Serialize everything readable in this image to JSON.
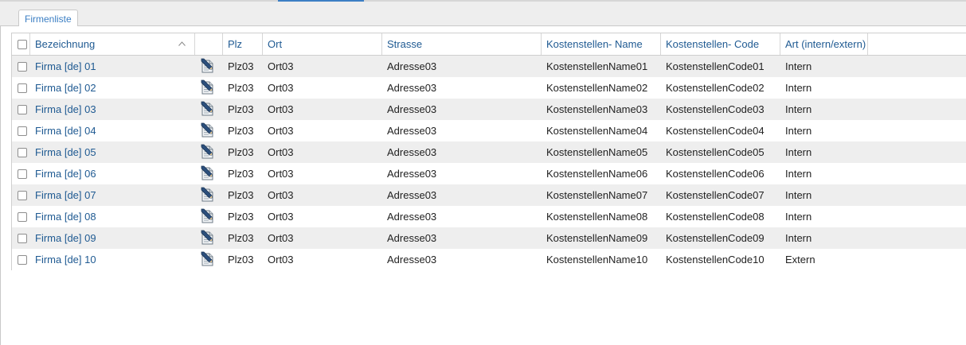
{
  "tabs": [
    {
      "label": "Firmenliste",
      "active": true
    }
  ],
  "table": {
    "columns": {
      "bezeichnung": "Bezeichnung",
      "plz": "Plz",
      "ort": "Ort",
      "strasse": "Strasse",
      "kostenstellen_name": "Kostenstellen- Name",
      "kostenstellen_code": "Kostenstellen- Code",
      "art": "Art (intern/extern)"
    },
    "sort": {
      "column": "bezeichnung",
      "direction": "ascending",
      "icon": "chevron-up-icon"
    },
    "rows": [
      {
        "bezeichnung": "Firma [de] 01",
        "plz": "Plz03",
        "ort": "Ort03",
        "strasse": "Adresse03",
        "kostenstellen_name": "KostenstellenName01",
        "kostenstellen_code": "KostenstellenCode01",
        "art": "Intern"
      },
      {
        "bezeichnung": "Firma [de] 02",
        "plz": "Plz03",
        "ort": "Ort03",
        "strasse": "Adresse03",
        "kostenstellen_name": "KostenstellenName02",
        "kostenstellen_code": "KostenstellenCode02",
        "art": "Intern"
      },
      {
        "bezeichnung": "Firma [de] 03",
        "plz": "Plz03",
        "ort": "Ort03",
        "strasse": "Adresse03",
        "kostenstellen_name": "KostenstellenName03",
        "kostenstellen_code": "KostenstellenCode03",
        "art": "Intern"
      },
      {
        "bezeichnung": "Firma [de] 04",
        "plz": "Plz03",
        "ort": "Ort03",
        "strasse": "Adresse03",
        "kostenstellen_name": "KostenstellenName04",
        "kostenstellen_code": "KostenstellenCode04",
        "art": "Intern"
      },
      {
        "bezeichnung": "Firma [de] 05",
        "plz": "Plz03",
        "ort": "Ort03",
        "strasse": "Adresse03",
        "kostenstellen_name": "KostenstellenName05",
        "kostenstellen_code": "KostenstellenCode05",
        "art": "Intern"
      },
      {
        "bezeichnung": "Firma [de] 06",
        "plz": "Plz03",
        "ort": "Ort03",
        "strasse": "Adresse03",
        "kostenstellen_name": "KostenstellenName06",
        "kostenstellen_code": "KostenstellenCode06",
        "art": "Intern"
      },
      {
        "bezeichnung": "Firma [de] 07",
        "plz": "Plz03",
        "ort": "Ort03",
        "strasse": "Adresse03",
        "kostenstellen_name": "KostenstellenName07",
        "kostenstellen_code": "KostenstellenCode07",
        "art": "Intern"
      },
      {
        "bezeichnung": "Firma [de] 08",
        "plz": "Plz03",
        "ort": "Ort03",
        "strasse": "Adresse03",
        "kostenstellen_name": "KostenstellenName08",
        "kostenstellen_code": "KostenstellenCode08",
        "art": "Intern"
      },
      {
        "bezeichnung": "Firma [de] 09",
        "plz": "Plz03",
        "ort": "Ort03",
        "strasse": "Adresse03",
        "kostenstellen_name": "KostenstellenName09",
        "kostenstellen_code": "KostenstellenCode09",
        "art": "Intern"
      },
      {
        "bezeichnung": "Firma [de] 10",
        "plz": "Plz03",
        "ort": "Ort03",
        "strasse": "Adresse03",
        "kostenstellen_name": "KostenstellenName10",
        "kostenstellen_code": "KostenstellenCode10",
        "art": "Extern"
      }
    ],
    "row_icon": "edit-icon"
  },
  "colors": {
    "link": "#1f5a92",
    "tab_text": "#3a7ec3",
    "row_alt": "#eeeeee",
    "accent": "#3c7fc4"
  }
}
